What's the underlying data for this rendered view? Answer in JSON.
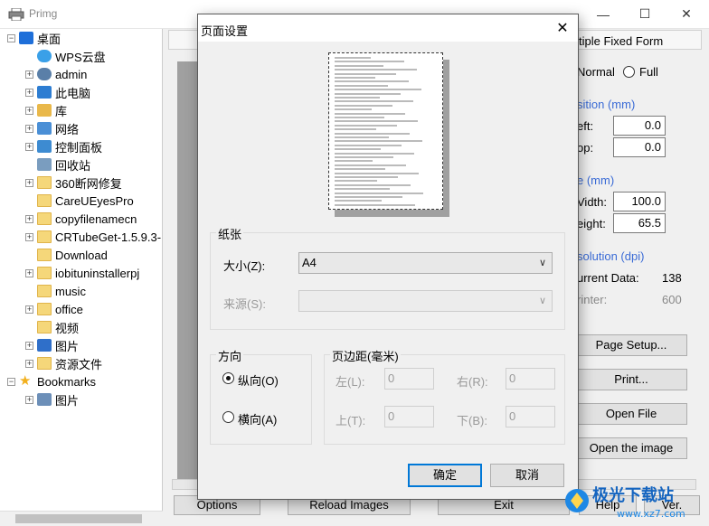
{
  "app": {
    "title": "Primg"
  },
  "window_controls": {
    "minimize": "—",
    "maximize": "☐",
    "close": "✕"
  },
  "tree": {
    "items": [
      {
        "label": "桌面",
        "icon": "desktop-icon",
        "level": 0,
        "expander": "−"
      },
      {
        "label": "WPS云盘",
        "icon": "cloud-icon",
        "level": 1,
        "expander": ""
      },
      {
        "label": "admin",
        "icon": "user-icon",
        "level": 1,
        "expander": "+"
      },
      {
        "label": "此电脑",
        "icon": "computer-icon",
        "level": 1,
        "expander": "+"
      },
      {
        "label": "库",
        "icon": "library-icon",
        "level": 1,
        "expander": "+"
      },
      {
        "label": "网络",
        "icon": "network-icon",
        "level": 1,
        "expander": "+"
      },
      {
        "label": "控制面板",
        "icon": "control-panel-icon",
        "level": 1,
        "expander": "+"
      },
      {
        "label": "回收站",
        "icon": "recycle-bin-icon",
        "level": 1,
        "expander": ""
      },
      {
        "label": "360断网修复",
        "icon": "folder-icon",
        "level": 1,
        "expander": "+"
      },
      {
        "label": "CareUEyesPro",
        "icon": "folder-icon",
        "level": 1,
        "expander": ""
      },
      {
        "label": "copyfilenamecn",
        "icon": "folder-icon",
        "level": 1,
        "expander": "+"
      },
      {
        "label": "CRTubeGet-1.5.9.3-",
        "icon": "folder-icon",
        "level": 1,
        "expander": "+"
      },
      {
        "label": "Download",
        "icon": "folder-icon",
        "level": 1,
        "expander": ""
      },
      {
        "label": "iobituninstallerpj",
        "icon": "folder-icon",
        "level": 1,
        "expander": "+"
      },
      {
        "label": "music",
        "icon": "folder-icon",
        "level": 1,
        "expander": ""
      },
      {
        "label": "office",
        "icon": "folder-icon",
        "level": 1,
        "expander": "+"
      },
      {
        "label": "视频",
        "icon": "folder-icon",
        "level": 1,
        "expander": ""
      },
      {
        "label": "图片",
        "icon": "shield-folder-icon",
        "level": 1,
        "expander": "+"
      },
      {
        "label": "资源文件",
        "icon": "folder-icon",
        "level": 1,
        "expander": "+"
      },
      {
        "label": "Bookmarks",
        "icon": "star-icon",
        "level": 0,
        "expander": "−"
      },
      {
        "label": "图片",
        "icon": "image-icon",
        "level": 1,
        "expander": "+"
      }
    ]
  },
  "right_panel": {
    "tab_label": "tiple Fixed Form",
    "mode_normal": "Normal",
    "mode_full": "Full",
    "position_heading": "sition (mm)",
    "left_label": "eft:",
    "left_value": "0.0",
    "top_label": "op:",
    "top_value": "0.0",
    "size_heading": "e (mm)",
    "width_label": "Vidth:",
    "width_value": "100.0",
    "height_label": "eight:",
    "height_value": "65.5",
    "resolution_heading": "solution (dpi)",
    "current_data_label": "urrent Data:",
    "current_data_value": "138",
    "printer_label": "rinter:",
    "printer_value": "600",
    "buttons": [
      "Page Setup...",
      "Print...",
      "Open File",
      "Open the image"
    ]
  },
  "bottom_bar": {
    "options": "Options",
    "reload": "Reload Images",
    "exit": "Exit",
    "help": "Help",
    "ver": "Ver."
  },
  "dialog": {
    "title": "页面设置",
    "close": "✕",
    "paper_group": "纸张",
    "size_label": "大小(Z):",
    "size_value": "A4",
    "source_label": "来源(S):",
    "source_value": "",
    "orientation_group": "方向",
    "portrait": "纵向(O)",
    "landscape": "横向(A)",
    "orientation_selected": "portrait",
    "margins_group": "页边距(毫米)",
    "left_label": "左(L):",
    "left_value": "0",
    "right_label": "右(R):",
    "right_value": "0",
    "top_label": "上(T):",
    "top_value": "0",
    "bottom_label": "下(B):",
    "bottom_value": "0",
    "ok": "确定",
    "cancel": "取消"
  },
  "watermark": {
    "text": "极光下载站",
    "url": "www.xz7.com"
  }
}
